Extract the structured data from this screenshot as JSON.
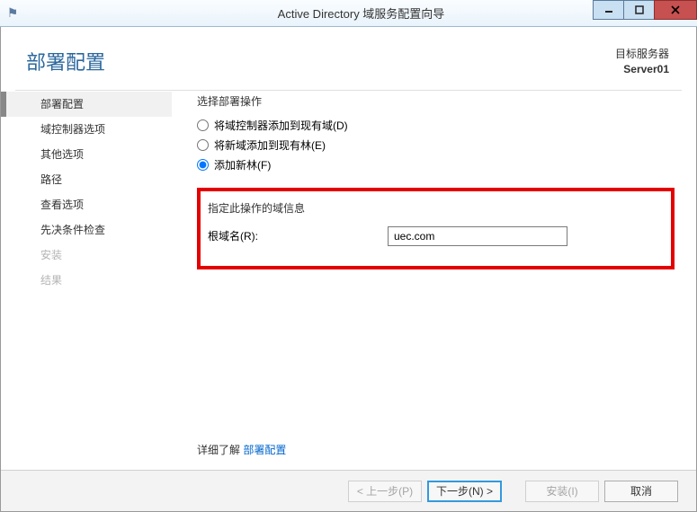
{
  "titlebar": {
    "title": "Active Directory 域服务配置向导"
  },
  "header": {
    "page_title": "部署配置",
    "target_label": "目标服务器",
    "target_name": "Server01"
  },
  "sidebar": {
    "items": [
      {
        "label": "部署配置",
        "active": true
      },
      {
        "label": "域控制器选项"
      },
      {
        "label": "其他选项"
      },
      {
        "label": "路径"
      },
      {
        "label": "查看选项"
      },
      {
        "label": "先决条件检查"
      },
      {
        "label": "安装",
        "disabled": true
      },
      {
        "label": "结果",
        "disabled": true
      }
    ]
  },
  "main": {
    "select_op_label": "选择部署操作",
    "radios": {
      "r1": "将域控制器添加到现有域(D)",
      "r2": "将新域添加到现有林(E)",
      "r3": "添加新林(F)"
    },
    "domain_info_label": "指定此操作的域信息",
    "root_domain_label": "根域名(R):",
    "root_domain_value": "uec.com",
    "more_prefix": "详细了解",
    "more_link": "部署配置"
  },
  "footer": {
    "prev": "< 上一步(P)",
    "next": "下一步(N) >",
    "install": "安装(I)",
    "cancel": "取消"
  }
}
